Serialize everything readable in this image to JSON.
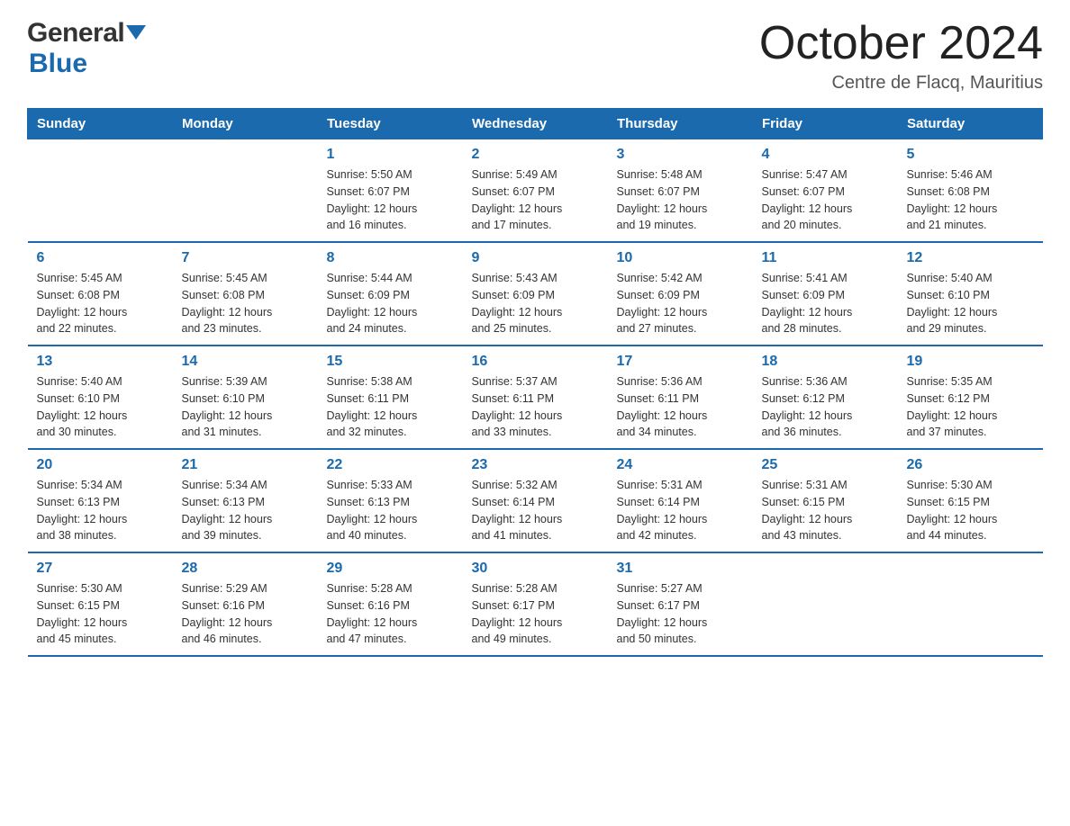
{
  "logo": {
    "general": "General",
    "blue": "Blue",
    "arrow": "▼"
  },
  "header": {
    "month_title": "October 2024",
    "subtitle": "Centre de Flacq, Mauritius"
  },
  "weekdays": [
    "Sunday",
    "Monday",
    "Tuesday",
    "Wednesday",
    "Thursday",
    "Friday",
    "Saturday"
  ],
  "weeks": [
    [
      {
        "day": "",
        "info": ""
      },
      {
        "day": "",
        "info": ""
      },
      {
        "day": "1",
        "info": "Sunrise: 5:50 AM\nSunset: 6:07 PM\nDaylight: 12 hours\nand 16 minutes."
      },
      {
        "day": "2",
        "info": "Sunrise: 5:49 AM\nSunset: 6:07 PM\nDaylight: 12 hours\nand 17 minutes."
      },
      {
        "day": "3",
        "info": "Sunrise: 5:48 AM\nSunset: 6:07 PM\nDaylight: 12 hours\nand 19 minutes."
      },
      {
        "day": "4",
        "info": "Sunrise: 5:47 AM\nSunset: 6:07 PM\nDaylight: 12 hours\nand 20 minutes."
      },
      {
        "day": "5",
        "info": "Sunrise: 5:46 AM\nSunset: 6:08 PM\nDaylight: 12 hours\nand 21 minutes."
      }
    ],
    [
      {
        "day": "6",
        "info": "Sunrise: 5:45 AM\nSunset: 6:08 PM\nDaylight: 12 hours\nand 22 minutes."
      },
      {
        "day": "7",
        "info": "Sunrise: 5:45 AM\nSunset: 6:08 PM\nDaylight: 12 hours\nand 23 minutes."
      },
      {
        "day": "8",
        "info": "Sunrise: 5:44 AM\nSunset: 6:09 PM\nDaylight: 12 hours\nand 24 minutes."
      },
      {
        "day": "9",
        "info": "Sunrise: 5:43 AM\nSunset: 6:09 PM\nDaylight: 12 hours\nand 25 minutes."
      },
      {
        "day": "10",
        "info": "Sunrise: 5:42 AM\nSunset: 6:09 PM\nDaylight: 12 hours\nand 27 minutes."
      },
      {
        "day": "11",
        "info": "Sunrise: 5:41 AM\nSunset: 6:09 PM\nDaylight: 12 hours\nand 28 minutes."
      },
      {
        "day": "12",
        "info": "Sunrise: 5:40 AM\nSunset: 6:10 PM\nDaylight: 12 hours\nand 29 minutes."
      }
    ],
    [
      {
        "day": "13",
        "info": "Sunrise: 5:40 AM\nSunset: 6:10 PM\nDaylight: 12 hours\nand 30 minutes."
      },
      {
        "day": "14",
        "info": "Sunrise: 5:39 AM\nSunset: 6:10 PM\nDaylight: 12 hours\nand 31 minutes."
      },
      {
        "day": "15",
        "info": "Sunrise: 5:38 AM\nSunset: 6:11 PM\nDaylight: 12 hours\nand 32 minutes."
      },
      {
        "day": "16",
        "info": "Sunrise: 5:37 AM\nSunset: 6:11 PM\nDaylight: 12 hours\nand 33 minutes."
      },
      {
        "day": "17",
        "info": "Sunrise: 5:36 AM\nSunset: 6:11 PM\nDaylight: 12 hours\nand 34 minutes."
      },
      {
        "day": "18",
        "info": "Sunrise: 5:36 AM\nSunset: 6:12 PM\nDaylight: 12 hours\nand 36 minutes."
      },
      {
        "day": "19",
        "info": "Sunrise: 5:35 AM\nSunset: 6:12 PM\nDaylight: 12 hours\nand 37 minutes."
      }
    ],
    [
      {
        "day": "20",
        "info": "Sunrise: 5:34 AM\nSunset: 6:13 PM\nDaylight: 12 hours\nand 38 minutes."
      },
      {
        "day": "21",
        "info": "Sunrise: 5:34 AM\nSunset: 6:13 PM\nDaylight: 12 hours\nand 39 minutes."
      },
      {
        "day": "22",
        "info": "Sunrise: 5:33 AM\nSunset: 6:13 PM\nDaylight: 12 hours\nand 40 minutes."
      },
      {
        "day": "23",
        "info": "Sunrise: 5:32 AM\nSunset: 6:14 PM\nDaylight: 12 hours\nand 41 minutes."
      },
      {
        "day": "24",
        "info": "Sunrise: 5:31 AM\nSunset: 6:14 PM\nDaylight: 12 hours\nand 42 minutes."
      },
      {
        "day": "25",
        "info": "Sunrise: 5:31 AM\nSunset: 6:15 PM\nDaylight: 12 hours\nand 43 minutes."
      },
      {
        "day": "26",
        "info": "Sunrise: 5:30 AM\nSunset: 6:15 PM\nDaylight: 12 hours\nand 44 minutes."
      }
    ],
    [
      {
        "day": "27",
        "info": "Sunrise: 5:30 AM\nSunset: 6:15 PM\nDaylight: 12 hours\nand 45 minutes."
      },
      {
        "day": "28",
        "info": "Sunrise: 5:29 AM\nSunset: 6:16 PM\nDaylight: 12 hours\nand 46 minutes."
      },
      {
        "day": "29",
        "info": "Sunrise: 5:28 AM\nSunset: 6:16 PM\nDaylight: 12 hours\nand 47 minutes."
      },
      {
        "day": "30",
        "info": "Sunrise: 5:28 AM\nSunset: 6:17 PM\nDaylight: 12 hours\nand 49 minutes."
      },
      {
        "day": "31",
        "info": "Sunrise: 5:27 AM\nSunset: 6:17 PM\nDaylight: 12 hours\nand 50 minutes."
      },
      {
        "day": "",
        "info": ""
      },
      {
        "day": "",
        "info": ""
      }
    ]
  ]
}
